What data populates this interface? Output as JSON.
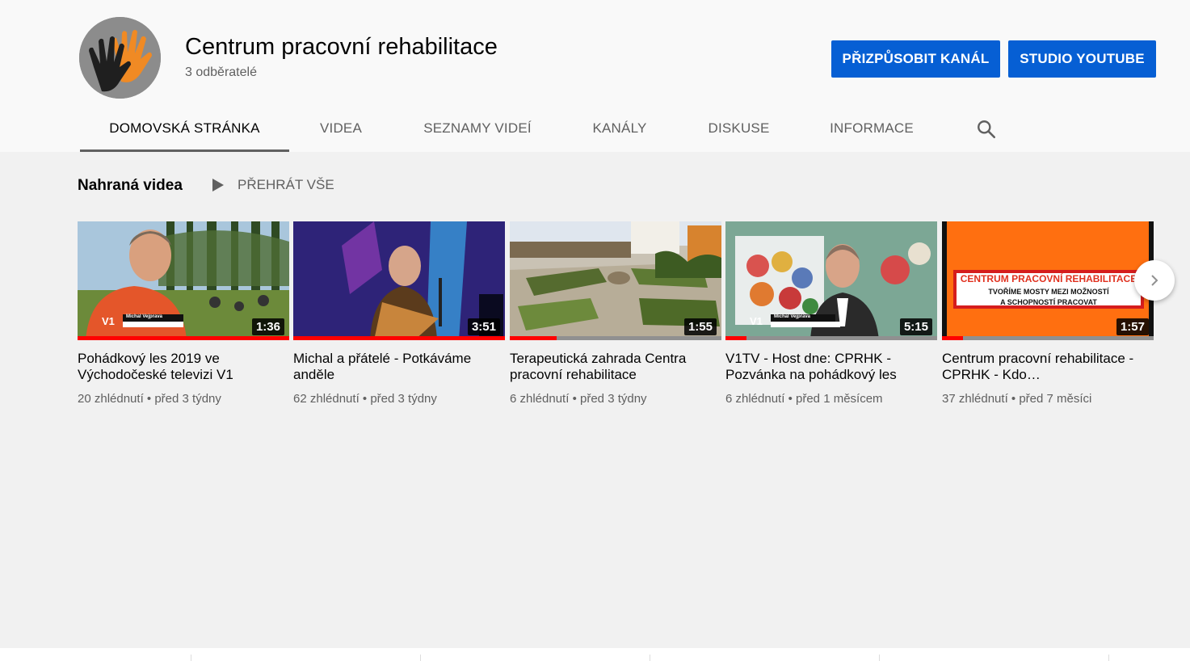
{
  "channel": {
    "name": "Centrum pracovní rehabilitace",
    "subscribers": "3 odběratelé",
    "avatar_icon": "hands-logo-icon"
  },
  "actions": {
    "customize_label": "PŘIZPŮSOBIT KANÁL",
    "studio_label": "STUDIO YOUTUBE",
    "accent": "#065fd4"
  },
  "tabs": [
    {
      "label": "DOMOVSKÁ STRÁNKA",
      "active": true
    },
    {
      "label": "VIDEA",
      "active": false
    },
    {
      "label": "SEZNAMY VIDEÍ",
      "active": false
    },
    {
      "label": "KANÁLY",
      "active": false
    },
    {
      "label": "DISKUSE",
      "active": false
    },
    {
      "label": "INFORMACE",
      "active": false
    }
  ],
  "section": {
    "title": "Nahraná videa",
    "play_all_label": "PŘEHRÁT VŠE"
  },
  "videos": [
    {
      "title": "Pohádkový les 2019 ve Východočeské televizi V1",
      "duration": "1:36",
      "views": "20 zhlédnutí",
      "age": "před 3 týdny",
      "watched": 1.0
    },
    {
      "title": "Michal a přátelé - Potkáváme anděle",
      "duration": "3:51",
      "views": "62 zhlédnutí",
      "age": "před 3 týdny",
      "watched": 1.0
    },
    {
      "title": "Terapeutická zahrada Centra pracovní rehabilitace",
      "duration": "1:55",
      "views": "6 zhlédnutí",
      "age": "před 3 týdny",
      "watched": 0.22
    },
    {
      "title": "V1TV - Host dne: CPRHK - Pozvánka na pohádkový les",
      "duration": "5:15",
      "views": "6 zhlédnutí",
      "age": "před 1 měsícem",
      "watched": 0.1
    },
    {
      "title": "Centrum pracovní rehabilitace - CPRHK - Kdo…",
      "duration": "1:57",
      "views": "37 zhlédnutí",
      "age": "před 7 měsíci",
      "watched": 0.1
    }
  ],
  "thumb5": {
    "line1": "CENTRUM PRACOVNÍ REHABILITACE",
    "line2": "TVOŘÍME MOSTY MEZI MOŽNOSTÍ",
    "line3": "A SCHOPNOSTÍ PRACOVAT"
  },
  "thumb_captions": {
    "v1_badge": "V1",
    "v1_name": "Michal Vejprava"
  },
  "meta_separator": "•"
}
